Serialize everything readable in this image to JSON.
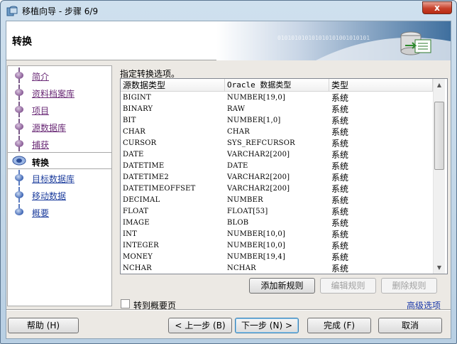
{
  "window": {
    "title": "移植向导 - 步骤 6/9",
    "close_label": "x"
  },
  "header": {
    "title": "转换",
    "banner_binary": "010101010101010101001010101"
  },
  "steps": [
    {
      "label": "简介",
      "state": "done"
    },
    {
      "label": "资料档案库",
      "state": "done"
    },
    {
      "label": "项目",
      "state": "done"
    },
    {
      "label": "源数据库",
      "state": "done"
    },
    {
      "label": "捕获",
      "state": "done"
    },
    {
      "label": "转换",
      "state": "current"
    },
    {
      "label": "目标数据库",
      "state": "pending"
    },
    {
      "label": "移动数据",
      "state": "pending"
    },
    {
      "label": "概要",
      "state": "pending"
    }
  ],
  "main": {
    "instruction": "指定转换选项。",
    "columns": [
      "源数据类型",
      "Oracle 数据类型",
      "类型"
    ],
    "rows": [
      [
        "BIGINT",
        "NUMBER[19,0]",
        "系统"
      ],
      [
        "BINARY",
        "RAW",
        "系统"
      ],
      [
        "BIT",
        "NUMBER[1,0]",
        "系统"
      ],
      [
        "CHAR",
        "CHAR",
        "系统"
      ],
      [
        "CURSOR",
        "SYS_REFCURSOR",
        "系统"
      ],
      [
        "DATE",
        "VARCHAR2[200]",
        "系统"
      ],
      [
        "DATETIME",
        "DATE",
        "系统"
      ],
      [
        "DATETIME2",
        "VARCHAR2[200]",
        "系统"
      ],
      [
        "DATETIMEOFFSET",
        "VARCHAR2[200]",
        "系统"
      ],
      [
        "DECIMAL",
        "NUMBER",
        "系统"
      ],
      [
        "FLOAT",
        "FLOAT[53]",
        "系统"
      ],
      [
        "IMAGE",
        "BLOB",
        "系统"
      ],
      [
        "INT",
        "NUMBER[10,0]",
        "系统"
      ],
      [
        "INTEGER",
        "NUMBER[10,0]",
        "系统"
      ],
      [
        "MONEY",
        "NUMBER[19,4]",
        "系统"
      ],
      [
        "NCHAR",
        "NCHAR",
        "系统"
      ]
    ],
    "add_rule": "添加新规则",
    "edit_rule": "编辑规则",
    "delete_rule": "删除规则",
    "goto_summary": "转到概要页",
    "advanced": "高级选项"
  },
  "footer": {
    "help": "帮助 (H)",
    "back": "< 上一步 (B)",
    "next": "下一步 (N) >",
    "finish": "完成 (F)",
    "cancel": "取消"
  }
}
